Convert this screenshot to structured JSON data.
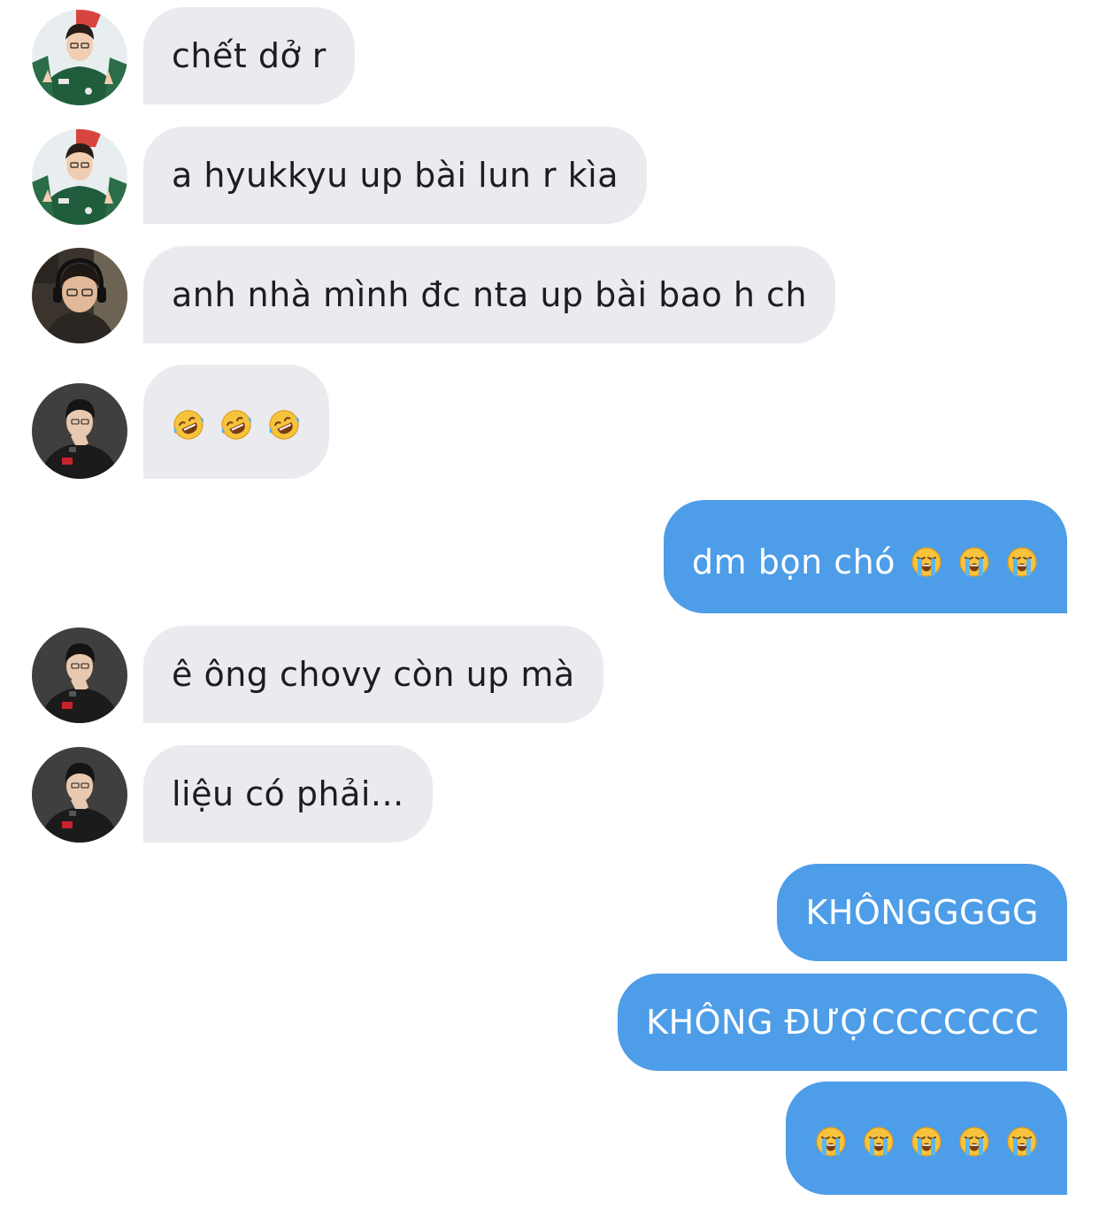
{
  "colors": {
    "incoming_bubble": "#e9ebef",
    "outgoing_bubble": "#4d9de8",
    "incoming_text": "#1d1d1f",
    "outgoing_text": "#ffffff"
  },
  "messages": [
    {
      "direction": "incoming",
      "avatar": "avatar-green-jacket",
      "text": "chết dở r"
    },
    {
      "direction": "incoming",
      "avatar": "avatar-green-jacket",
      "text": "a hyukkyu up bài lun r kìa"
    },
    {
      "direction": "incoming",
      "avatar": "avatar-glasses-headset",
      "text": "anh nhà mình đc nta up bài bao h ch"
    },
    {
      "direction": "incoming",
      "avatar": "avatar-black-hoodie",
      "text": "",
      "emojis": [
        "rolling-on-floor-laughing-emoji",
        "rolling-on-floor-laughing-emoji",
        "rolling-on-floor-laughing-emoji"
      ]
    },
    {
      "direction": "outgoing",
      "text": "dm bọn chó",
      "emojis": [
        "loudly-crying-face-emoji",
        "loudly-crying-face-emoji",
        "loudly-crying-face-emoji"
      ]
    },
    {
      "direction": "incoming",
      "avatar": "avatar-black-hoodie",
      "text": "ê ông chovy còn up mà"
    },
    {
      "direction": "incoming",
      "avatar": "avatar-black-hoodie",
      "text": "liệu có phải..."
    },
    {
      "direction": "outgoing",
      "text": "KHÔNGGGGG"
    },
    {
      "direction": "outgoing",
      "text": "KHÔNG ĐƯỢCCCCCCC"
    },
    {
      "direction": "outgoing",
      "text": "",
      "emojis": [
        "loudly-crying-face-emoji",
        "loudly-crying-face-emoji",
        "loudly-crying-face-emoji",
        "loudly-crying-face-emoji",
        "loudly-crying-face-emoji"
      ]
    }
  ]
}
